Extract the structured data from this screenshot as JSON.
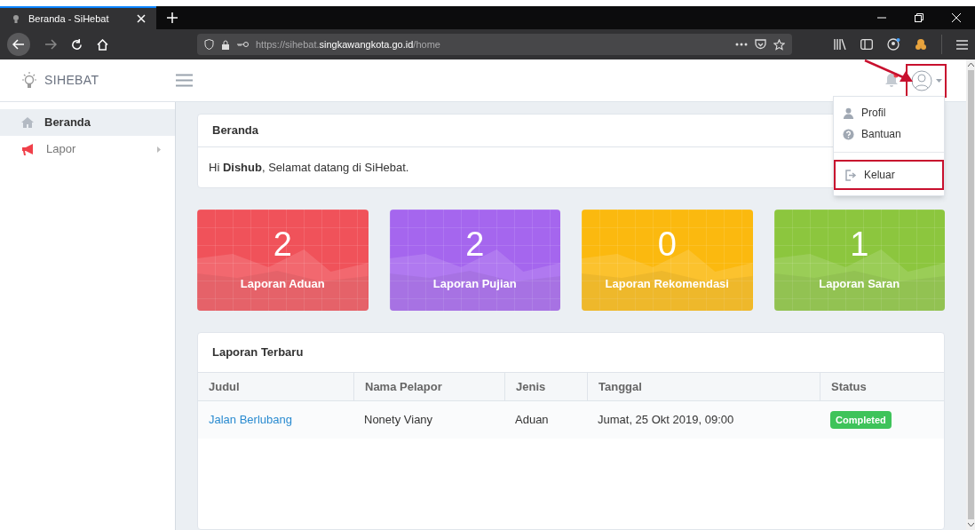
{
  "browser": {
    "tab_title": "Beranda - SiHebat",
    "url_prefix": "https://sihebat.",
    "url_domain": "singkawangkota.go.id",
    "url_path": "/home"
  },
  "brand": "SIHEBAT",
  "sidebar": {
    "items": [
      {
        "label": "Beranda",
        "selected": true,
        "submenu": false,
        "kind": "home"
      },
      {
        "label": "Lapor",
        "selected": false,
        "submenu": true,
        "kind": "megaphone"
      }
    ]
  },
  "header": {
    "notification_unread": true,
    "avatar_annotated": true
  },
  "user_menu": {
    "groups": [
      {
        "items": [
          {
            "label": "Profil",
            "kind": "profile",
            "annotated": false
          },
          {
            "label": "Bantuan",
            "kind": "help",
            "annotated": false
          }
        ]
      },
      {
        "items": [
          {
            "label": "Keluar",
            "kind": "logout",
            "annotated": true
          }
        ]
      }
    ]
  },
  "welcome_card": {
    "title": "Beranda",
    "message": "Hi **Dishub**, Selamat datang di SiHebat."
  },
  "stats": [
    {
      "value": "2",
      "label": "Laporan Aduan",
      "color": "#f0525a"
    },
    {
      "value": "2",
      "label": "Laporan Pujian",
      "color": "#a566ee"
    },
    {
      "value": "0",
      "label": "Laporan Rekomendasi",
      "color": "#fbb90f"
    },
    {
      "value": "1",
      "label": "Laporan Saran",
      "color": "#8cc63e"
    }
  ],
  "table": {
    "title": "Laporan Terbaru",
    "columns": [
      "Judul",
      "Nama Pelapor",
      "Jenis",
      "Tanggal",
      "Status"
    ],
    "rows": [
      {
        "title": "Jalan Berlubang",
        "reporter": "Nonety Viany",
        "type": "Aduan",
        "date": "Jumat, 25 Okt 2019, 09:00",
        "status": "Completed"
      }
    ]
  }
}
